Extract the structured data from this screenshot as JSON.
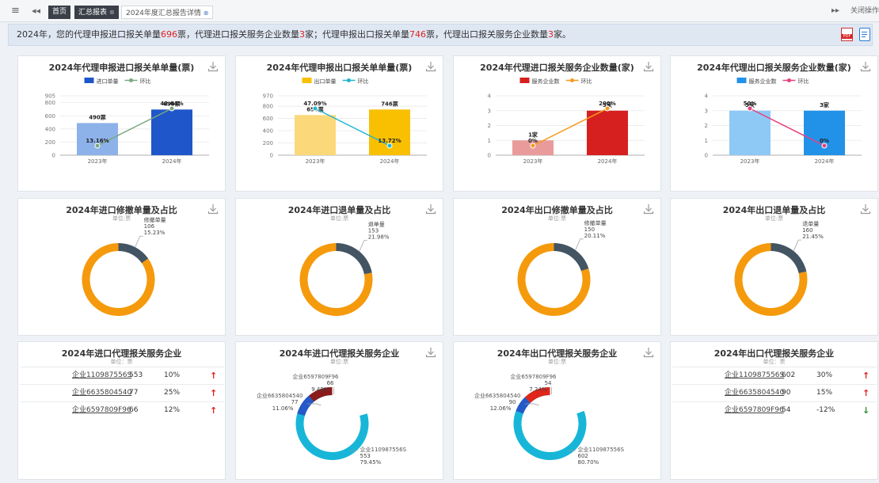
{
  "tabs": {
    "home": "首页",
    "summary_report": "汇总报表",
    "detail": "2024年度汇总报告详情",
    "close_ops": "关闭操作"
  },
  "summary": {
    "p1": "2024年，您的代理申报进口报关单量",
    "v1": "696",
    "p2": "票，代理进口报关服务企业数量",
    "v2": "3",
    "p3": "家；代理申报出口报关单量",
    "v3": "746",
    "p4": "票，代理出口报关服务企业数量",
    "v4": "3",
    "p5": "家。"
  },
  "colors": {
    "orange": "#f59a0c",
    "slate": "#435462",
    "cyan": "#17b6d8",
    "darkred": "#8b1a1a",
    "red": "#e0251b",
    "blue": "#2558c8",
    "up": "#e02020",
    "down": "#2a8a2a"
  },
  "chart_data": [
    {
      "type": "bar",
      "title": "2024年代理申报进口报关单单量(票)",
      "categories": [
        "2023年",
        "2024年"
      ],
      "series": [
        {
          "name": "进口单量",
          "values": [
            490,
            696
          ],
          "colors": [
            "#8db2ea",
            "#1f56c9"
          ],
          "labels": [
            "490票",
            "696票"
          ]
        },
        {
          "name": "环比",
          "values": [
            13.16,
            42.04
          ],
          "type": "line",
          "color": "#7aa882",
          "labels": [
            "13.16%",
            "42.04%"
          ]
        }
      ],
      "yticks": [
        0,
        200,
        400,
        600,
        800,
        905
      ],
      "ylim": [
        0,
        905
      ]
    },
    {
      "type": "bar",
      "title": "2024年代理申报出口报关单单量(票)",
      "categories": [
        "2023年",
        "2024年"
      ],
      "series": [
        {
          "name": "出口单量",
          "values": [
            656,
            746
          ],
          "colors": [
            "#fbd97a",
            "#f8c000"
          ],
          "labels": [
            "656票",
            "746票"
          ]
        },
        {
          "name": "环比",
          "values": [
            47.09,
            13.72
          ],
          "type": "line",
          "color": "#20b6cf",
          "labels": [
            "47.09%",
            "13.72%"
          ]
        }
      ],
      "yticks": [
        0,
        200,
        400,
        600,
        800,
        970
      ],
      "ylim": [
        0,
        970
      ]
    },
    {
      "type": "bar",
      "title": "2024年代理进口报关服务企业数量(家)",
      "categories": [
        "2023年",
        "2024年"
      ],
      "series": [
        {
          "name": "服务企业数",
          "values": [
            1,
            3
          ],
          "colors": [
            "#e99b9b",
            "#d62020"
          ],
          "labels": [
            "1家",
            "3家"
          ]
        },
        {
          "name": "环比",
          "values": [
            0,
            200
          ],
          "type": "line",
          "color": "#f59a1e",
          "labels": [
            "0%",
            "200%"
          ]
        }
      ],
      "yticks": [
        0,
        1,
        2,
        3,
        4
      ],
      "ylim": [
        0,
        4
      ]
    },
    {
      "type": "bar",
      "title": "2024年代理出口报关服务企业数量(家)",
      "categories": [
        "2023年",
        "2024年"
      ],
      "series": [
        {
          "name": "服务企业数",
          "values": [
            3,
            3
          ],
          "colors": [
            "#8ec9f5",
            "#2192e8"
          ],
          "labels": [
            "3家",
            "3家"
          ]
        },
        {
          "name": "环比",
          "values": [
            50,
            0
          ],
          "type": "line",
          "color": "#e7407f",
          "labels": [
            "50%",
            "0%"
          ]
        }
      ],
      "yticks": [
        0,
        1,
        2,
        3,
        4
      ],
      "ylim": [
        0,
        4
      ]
    },
    {
      "type": "pie",
      "title": "2024年进口修撤单量及占比",
      "unit": "单位:票",
      "label": "修撤单量",
      "value": 106,
      "percent": "15.23%",
      "fraction": 0.1523
    },
    {
      "type": "pie",
      "title": "2024年进口退单量及占比",
      "unit": "单位:票",
      "label": "退单量",
      "value": 153,
      "percent": "21.98%",
      "fraction": 0.2198
    },
    {
      "type": "pie",
      "title": "2024年出口修撤单量及占比",
      "unit": "单位:票",
      "label": "修撤单量",
      "value": 150,
      "percent": "20.11%",
      "fraction": 0.2011
    },
    {
      "type": "pie",
      "title": "2024年出口退单量及占比",
      "unit": "单位:票",
      "label": "退单量",
      "value": 160,
      "percent": "21.45%",
      "fraction": 0.2145
    },
    {
      "type": "table",
      "title": "2024年进口代理报关服务企业",
      "unit": "单位：票",
      "rows": [
        {
          "name": "企业110987556S",
          "value": "553",
          "pct": "10%",
          "trend": "up"
        },
        {
          "name": "企业6635804540",
          "value": "77",
          "pct": "25%",
          "trend": "up"
        },
        {
          "name": "企业6597809F96",
          "value": "66",
          "pct": "12%",
          "trend": "up"
        }
      ]
    },
    {
      "type": "pie",
      "title": "2024年进口代理报关服务企业",
      "unit": "单位:票",
      "slices": [
        {
          "name": "企业110987556S",
          "value": 553,
          "percent": "79.45%",
          "fraction": 0.7945
        },
        {
          "name": "企业6635804540",
          "value": 77,
          "percent": "11.06%",
          "fraction": 0.1106
        },
        {
          "name": "企业6597809F96",
          "value": 66,
          "percent": "9.48%",
          "fraction": 0.0948
        }
      ]
    },
    {
      "type": "pie",
      "title": "2024年出口代理报关服务企业",
      "unit": "单位:票",
      "slices": [
        {
          "name": "企业110987556S",
          "value": 602,
          "percent": "80.70%",
          "fraction": 0.807
        },
        {
          "name": "企业6635804540",
          "value": 90,
          "percent": "12.06%",
          "fraction": 0.1206
        },
        {
          "name": "企业6597809F96",
          "value": 54,
          "percent": "7.24%",
          "fraction": 0.0724
        }
      ]
    },
    {
      "type": "table",
      "title": "2024年出口代理报关服务企业",
      "unit": "单位：票",
      "rows": [
        {
          "name": "企业110987556S",
          "value": "602",
          "pct": "30%",
          "trend": "up"
        },
        {
          "name": "企业6635804540",
          "value": "90",
          "pct": "15%",
          "trend": "up"
        },
        {
          "name": "企业6597809F96",
          "value": "54",
          "pct": "-12%",
          "trend": "down"
        }
      ]
    }
  ]
}
